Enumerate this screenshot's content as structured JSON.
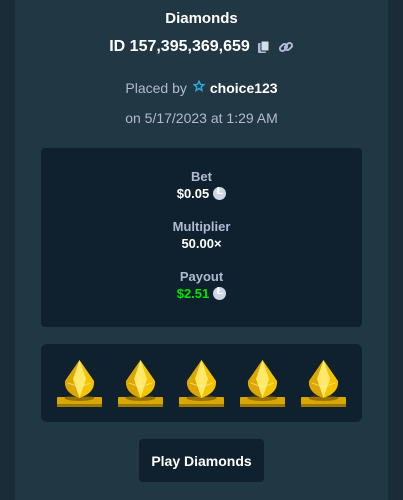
{
  "modal": {
    "title": "Diamonds",
    "bet_id": "ID 157,395,369,659",
    "placed_by_label": "Placed by",
    "username": "choice123",
    "date": "on 5/17/2023 at 1:29 AM"
  },
  "stats": {
    "bet_label": "Bet",
    "bet_value": "$0.05",
    "multiplier_label": "Multiplier",
    "multiplier_value": "50.00×",
    "payout_label": "Payout",
    "payout_value": "$2.51",
    "currency_icon": "litecoin-icon"
  },
  "tiles": {
    "count": 5,
    "gem": "yellow-diamond-icon",
    "colors": {
      "gem_light": "#ffe86b",
      "gem_mid": "#f5c400",
      "gem_dark": "#c98f00",
      "base": "#d9a800"
    }
  },
  "actions": {
    "play_label": "Play Diamonds"
  },
  "colors": {
    "background": "#1a2c38",
    "panel": "#213743",
    "inner_box": "#0f212e",
    "muted_text": "#b1bad3",
    "win_green": "#00e701",
    "star": "#2fa7d8"
  }
}
